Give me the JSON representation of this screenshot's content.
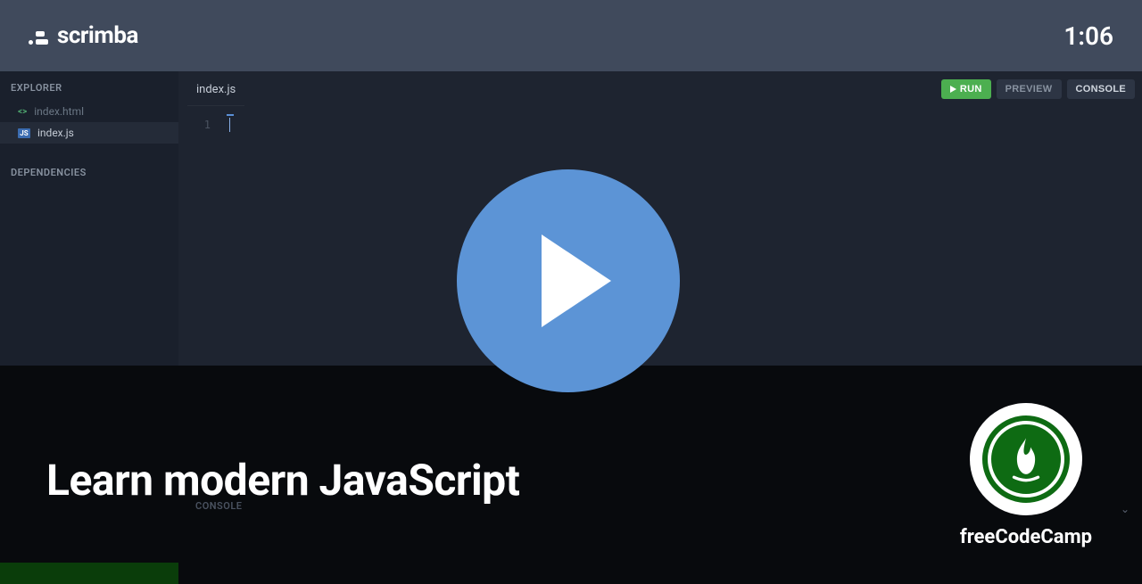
{
  "header": {
    "brand": "scrimba",
    "timer": "1:06"
  },
  "sidebar": {
    "explorer_heading": "EXPLORER",
    "dependencies_heading": "DEPENDENCIES",
    "files": [
      {
        "name": "index.html",
        "icon": "html",
        "active": false
      },
      {
        "name": "index.js",
        "icon": "js",
        "active": true
      }
    ]
  },
  "editor": {
    "active_tab": "index.js",
    "line_number": "1",
    "buttons": {
      "run": "RUN",
      "preview": "PREVIEW",
      "console": "CONSOLE"
    }
  },
  "console_panel": {
    "label": "CONSOLE"
  },
  "overlay": {
    "course_title": "Learn modern JavaScript",
    "author": "freeCodeCamp"
  }
}
